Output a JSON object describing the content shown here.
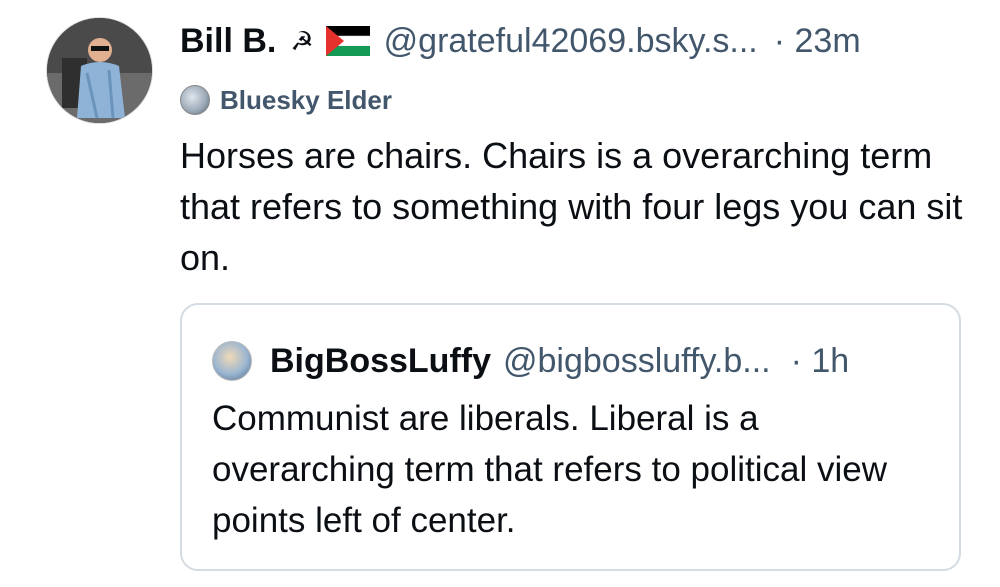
{
  "post": {
    "author": {
      "display_name": "Bill B.",
      "name_emoji_1": "☭",
      "handle": "@grateful42069.bsky.s...",
      "timestamp": "· 23m"
    },
    "label": "Bluesky Elder",
    "text": "Horses are chairs. Chairs is a overarching term that refers to something with four legs you can sit on."
  },
  "quote": {
    "author": {
      "display_name": "BigBossLuffy",
      "handle": "@bigbossluffy.b...",
      "timestamp": "· 1h"
    },
    "text": "Communist are liberals. Liberal is a overarching term that refers to political view points left of center."
  },
  "icons": {
    "avatar": "user-avatar-photo",
    "flag": "palestine-flag-icon",
    "label_icon": "bluesky-elder-badge-icon",
    "quote_avatar": "quote-author-avatar"
  },
  "colors": {
    "text_primary": "#0b0f14",
    "text_secondary": "#42576c",
    "card_border": "#d4dbe2",
    "background": "#ffffff"
  }
}
